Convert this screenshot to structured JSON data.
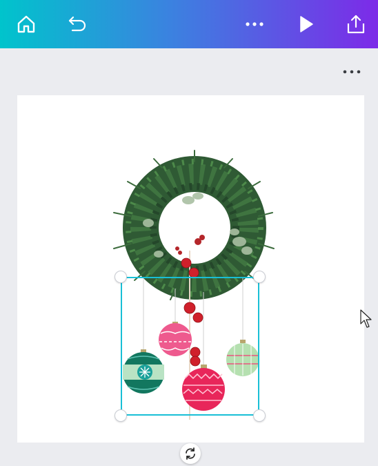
{
  "toolbar": {
    "home": "home-icon",
    "undo": "undo-icon",
    "more": "more-horizontal-icon",
    "present": "play-icon",
    "share": "share-upload-icon"
  },
  "page_menu": "more-horizontal-icon",
  "canvas": {
    "background": "#ffffff",
    "elements": [
      {
        "kind": "image",
        "description": "wreath-image"
      },
      {
        "kind": "graphic",
        "description": "hanging-ornaments-graphic",
        "selected": true
      }
    ]
  },
  "selection": {
    "color": "#18bfd6",
    "rotate_icon": "rotate-icon"
  },
  "colors": {
    "gradient_start": "#00c4cc",
    "gradient_end": "#7d2ae8",
    "workspace": "#ebecf0"
  }
}
